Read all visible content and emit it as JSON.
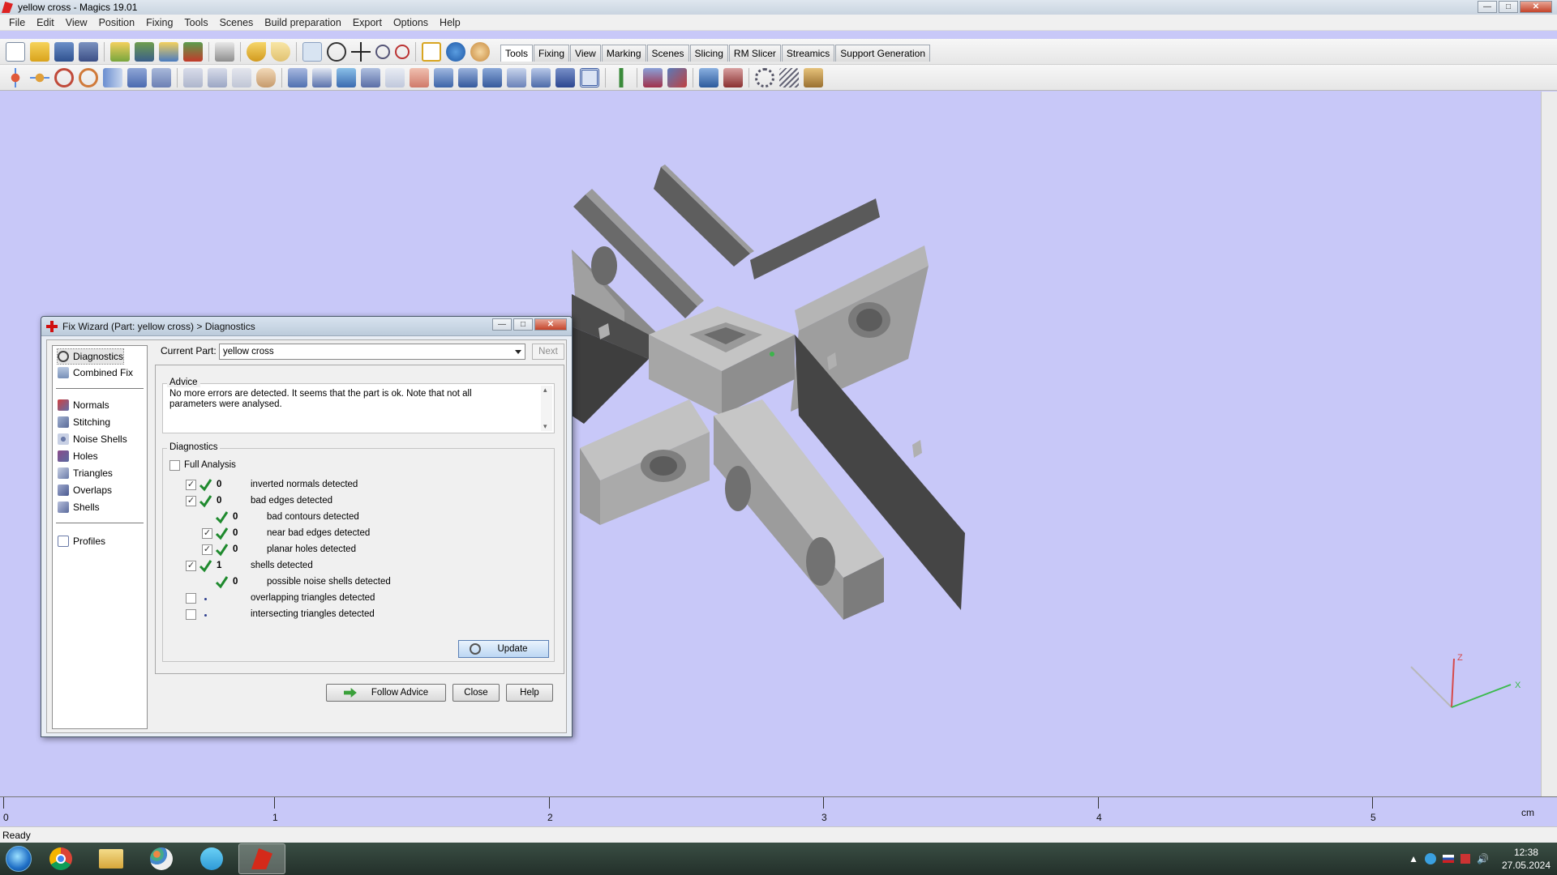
{
  "window": {
    "title": "yellow cross - Magics 19.01",
    "minimize": "—",
    "maximize": "□",
    "close": "✕"
  },
  "menu": [
    "File",
    "Edit",
    "View",
    "Position",
    "Fixing",
    "Tools",
    "Scenes",
    "Build preparation",
    "Export",
    "Options",
    "Help"
  ],
  "tabs": [
    "Tools",
    "Fixing",
    "View",
    "Marking",
    "Scenes",
    "Slicing",
    "RM Slicer",
    "Streamics",
    "Support Generation"
  ],
  "active_tab": "Tools",
  "dialog": {
    "title": "Fix Wizard (Part: yellow cross) > Diagnostics",
    "current_part_label": "Current Part:",
    "current_part_value": "yellow cross",
    "next_label": "Next",
    "nav": {
      "top": [
        "Diagnostics",
        "Combined Fix"
      ],
      "fixes": [
        "Normals",
        "Stitching",
        "Noise Shells",
        "Holes",
        "Triangles",
        "Overlaps",
        "Shells"
      ],
      "bottom": [
        "Profiles"
      ]
    },
    "advice_title": "Advice",
    "advice_text": "No more errors are detected. It seems that the part is ok. Note that not all parameters were analysed.",
    "diagnostics_title": "Diagnostics",
    "full_analysis_label": "Full Analysis",
    "rows": [
      {
        "checked": true,
        "ok": true,
        "count": "0",
        "label": "inverted normals detected",
        "indent": 0
      },
      {
        "checked": true,
        "ok": true,
        "count": "0",
        "label": "bad edges detected",
        "indent": 0
      },
      {
        "checked": null,
        "ok": true,
        "count": "0",
        "label": "bad contours detected",
        "indent": 1
      },
      {
        "checked": true,
        "ok": true,
        "count": "0",
        "label": "near bad edges detected",
        "indent": 1
      },
      {
        "checked": true,
        "ok": true,
        "count": "0",
        "label": "planar holes detected",
        "indent": 1
      },
      {
        "checked": true,
        "ok": true,
        "count": "1",
        "label": "shells detected",
        "indent": 0
      },
      {
        "checked": null,
        "ok": true,
        "count": "0",
        "label": "possible noise shells detected",
        "indent": 1
      },
      {
        "checked": false,
        "ok": false,
        "count": "",
        "label": "overlapping triangles detected",
        "indent": 0
      },
      {
        "checked": false,
        "ok": false,
        "count": "",
        "label": "intersecting triangles detected",
        "indent": 0
      }
    ],
    "update_label": "Update",
    "follow_advice_label": "Follow Advice",
    "close_label": "Close",
    "help_label": "Help"
  },
  "ruler": {
    "labels": [
      "0",
      "1",
      "2",
      "3",
      "4",
      "5"
    ],
    "unit": "cm"
  },
  "axes": {
    "x": "X",
    "z": "Z"
  },
  "status": "Ready",
  "taskbar": {
    "time": "12:38",
    "date": "27.05.2024",
    "apps": [
      "chrome-icon",
      "explorer-icon",
      "paint-icon",
      "vpn-icon",
      "magics-icon"
    ]
  },
  "colors": {
    "viewport": "#c8c8f8",
    "part": "#8c8c8c",
    "ok_tick": "#1f8a2e"
  }
}
